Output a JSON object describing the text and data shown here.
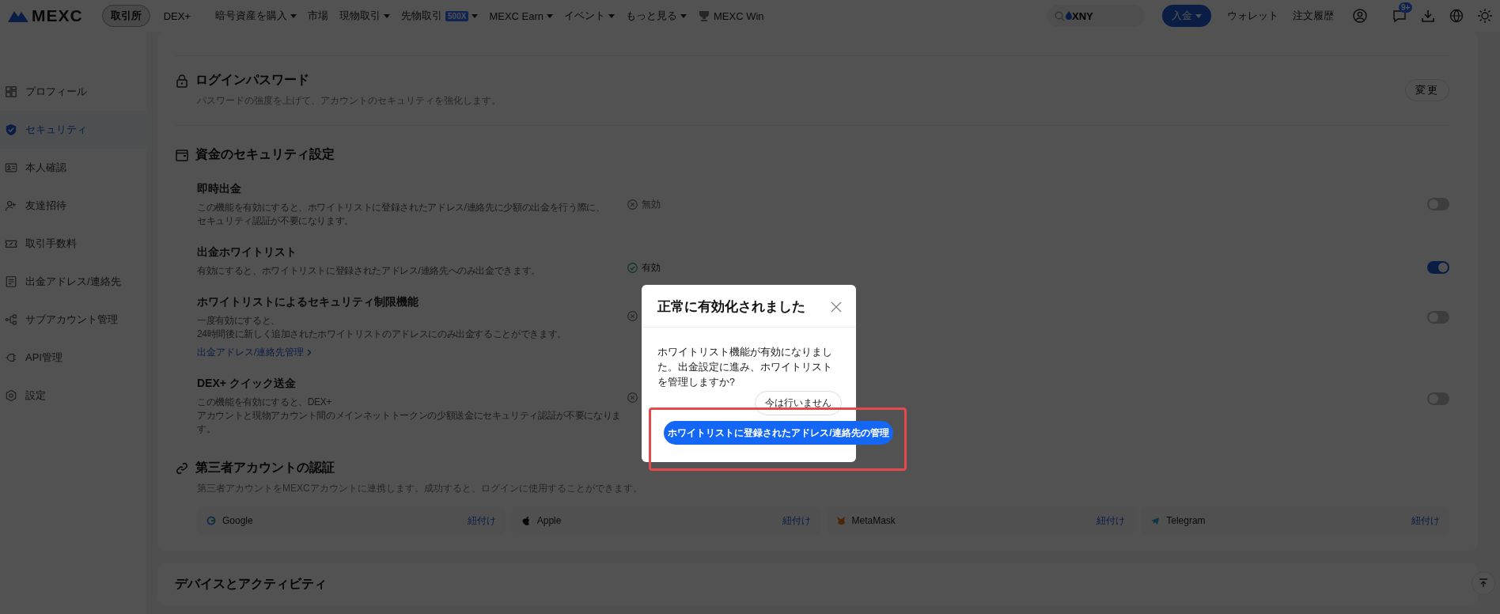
{
  "topbar": {
    "logo": "MEXC",
    "nav": [
      {
        "label": "取引所",
        "selected": true
      },
      {
        "label": "DEX+",
        "selected": false
      }
    ],
    "menu": [
      {
        "label": "暗号資産を購入",
        "dropdown": true
      },
      {
        "label": "市場",
        "dropdown": false
      },
      {
        "label": "現物取引",
        "dropdown": true
      },
      {
        "label": "先物取引",
        "badge": "500X",
        "dropdown": true
      },
      {
        "label": "MEXC Earn",
        "dropdown": true
      },
      {
        "label": "イベント",
        "dropdown": true
      },
      {
        "label": "もっと見る",
        "dropdown": true
      },
      {
        "label": "MEXC Win",
        "dropdown": false,
        "kind": "icon-link"
      }
    ],
    "search": {
      "placeholder": "XNY"
    },
    "deposit": "入金",
    "links": [
      "ウォレット",
      "注文履歴"
    ],
    "notification_badge": "9+"
  },
  "sidebar": {
    "items": [
      {
        "label": "プロフィール",
        "selected": false
      },
      {
        "label": "セキュリティ",
        "selected": true
      },
      {
        "label": "本人確認",
        "selected": false
      },
      {
        "label": "友達招待",
        "selected": false
      },
      {
        "label": "取引手数料",
        "selected": false
      },
      {
        "label": "出金アドレス/連絡先",
        "selected": false
      },
      {
        "label": "サブアカウント管理",
        "selected": false
      },
      {
        "label": "API管理",
        "selected": false
      },
      {
        "label": "設定",
        "selected": false
      }
    ]
  },
  "login_password": {
    "title": "ログインパスワード",
    "description": "パスワードの強度を上げて、アカウントのセキュリティを強化します。",
    "button": "変更"
  },
  "funds_security": {
    "title": "資金のセキュリティ設定",
    "rows": [
      {
        "title": "即時出金",
        "description": [
          "この機能を有効にすると、ホワイトリストに登録されたアドレス/連絡先に少額の出金を行う際に、",
          "セキュリティ認証が不要になります。"
        ],
        "status": {
          "enabled": false,
          "label": "無効"
        },
        "on": false
      },
      {
        "title": "出金ホワイトリスト",
        "description": [
          "有効にすると、ホワイトリストに登録されたアドレス/連絡先へのみ出金できます。"
        ],
        "status": {
          "enabled": true,
          "label": "有効"
        },
        "on": true
      },
      {
        "title": "ホワイトリストによるセキュリティ制限機能",
        "description": [
          "一度有効にすると、",
          "24時間後に新しく追加されたホワイトリストのアドレスにのみ出金することができます。"
        ],
        "link": "出金アドレス/連絡先管理",
        "status": {
          "enabled": false
        },
        "on": false
      },
      {
        "title": "DEX+ クイック送金",
        "description": [
          "この機能を有効にすると、DEX+",
          "アカウントと現物アカウント間のメインネットトークンの少額送金にセキュリティ認証が不要になりま",
          "す。"
        ],
        "status": {
          "enabled": false
        },
        "on": false
      }
    ]
  },
  "third_party": {
    "title": "第三者アカウントの認証",
    "description": "第三者アカウントをMEXCアカウントに連携します。成功すると、ログインに使用することができます。",
    "accounts": [
      {
        "name": "Google",
        "action": "紐付け"
      },
      {
        "name": "Apple",
        "action": "紐付け"
      },
      {
        "name": "MetaMask",
        "action": "紐付け"
      },
      {
        "name": "Telegram",
        "action": "紐付け"
      }
    ]
  },
  "devices": {
    "title": "デバイスとアクティビティ"
  },
  "modal": {
    "title": "正常に有効化されました",
    "body": "ホワイトリスト機能が有効になりました。出金設定に進み、ホワイトリストを管理しますか?",
    "secondary_button": "今は行いません",
    "primary_button": "ホワイトリストに登録されたアドレス/連絡先の管理"
  }
}
